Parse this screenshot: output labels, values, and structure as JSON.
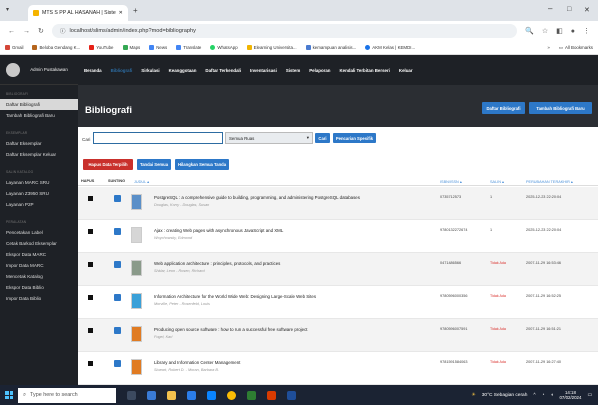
{
  "browser": {
    "tab_title": "MTS S PP AL HASANAH | Siste",
    "url": "localhost/slims/admin/index.php?mod=bibliography",
    "bookmarks": [
      "Gmail",
      "Beloba Gendang K...",
      "YouTube",
      "Maps",
      "News",
      "Translate",
      "WhatsApp",
      "Elearning Universita...",
      "kemampuan analisis...",
      "AKM Kelas | KEMDI..."
    ],
    "all_bookmarks_label": "All Bookmarks"
  },
  "sidebar": {
    "user": "Admin Pustakawan",
    "groups": [
      {
        "label": "BIBLIOGRAFI",
        "items": [
          "Daftar Bibliografi",
          "Tambah Bibliografi Baru"
        ]
      },
      {
        "label": "EKSEMPLAR",
        "items": [
          "Daftar Eksemplar",
          "Daftar Eksemplar Keluar"
        ]
      },
      {
        "label": "SALIN KATALOG",
        "items": [
          "Layanan MARC SRU",
          "Layanan Z3950 SRU",
          "Layanan P2P"
        ]
      },
      {
        "label": "PERALATAN",
        "items": [
          "Pencetakan Label",
          "Cetak Barkod Eksemplar",
          "Ekspor Data MARC",
          "Impor Data MARC",
          "Mencetak Katalog",
          "Ekspor Data Biblio",
          "Impor Data Biblio"
        ]
      }
    ]
  },
  "topnav": [
    "Beranda",
    "Bibliografi",
    "Sirkulasi",
    "Keanggotaan",
    "Daftar Terkendali",
    "Inventarisasi",
    "Sistem",
    "Pelaporan",
    "Kendali Terbitan Berseri",
    "Keluar"
  ],
  "main": {
    "title": "Bibliografi",
    "btn_list": "Daftar Bibliografi",
    "btn_add": "Tambah Bibliografi Baru",
    "search_label": "Cari",
    "search_value": "",
    "search_field": "Semua Ruas",
    "btn_search": "Cari",
    "btn_advanced": "Pencarian Spesifik",
    "btn_delete": "Hapus Data Terpilih",
    "btn_select_all": "Tandai Semua",
    "btn_unselect": "Hilangkan Semua Tanda"
  },
  "table": {
    "headers": {
      "delete": "HAPUS",
      "edit": "SUNTING",
      "title": "JUDUL ▴",
      "isbn": "ISBN/ISSN ▴",
      "copies": "SALIN ▴",
      "updated": "PERUBAHAN TERAKHIR ▴"
    },
    "rows": [
      {
        "title": "PostgreSQL : a comprehensive guide to building, programming, and administering PostgreSQL databases",
        "authors": "Douglas, Korry - Douglas, Susan",
        "isbn": "0735712573",
        "copies": "1",
        "updated": "2025-12-23 22:20:04",
        "thumb": "#5a8fc8"
      },
      {
        "title": "Ajax : creating Web pages with asynchronous JavaScript and XML",
        "authors": "Woychowsky, Edmond",
        "isbn": "9780132272674",
        "copies": "1",
        "updated": "2025-12-23 22:20:04",
        "thumb": "#d6d6d6"
      },
      {
        "title": "Web application architecture : principles, protocols, and practices",
        "authors": "Shklar, Leon - Rosen, Richard",
        "isbn": "0471486566",
        "copies": "Tidak Ada",
        "updated": "2007-11-29 16:53:46",
        "thumb": "#8a9a8a"
      },
      {
        "title": "Information Architecture for the World Wide Web: Designing Large-Scale Web Sites",
        "authors": "Morville, Peter - Rosenfeld, Louis",
        "isbn": "9780596000356",
        "copies": "Tidak Ada",
        "updated": "2007-11-29 16:52:25",
        "thumb": "#3aa0d8"
      },
      {
        "title": "Producing open source software : how to run a successful free software project",
        "authors": "Fogel, Karl",
        "isbn": "9780596007591",
        "copies": "Tidak Ada",
        "updated": "2007-11-29 16:51:21",
        "thumb": "#e07b22"
      },
      {
        "title": "Library and Information Center Management",
        "authors": "Stueart, Robert D. - Moran, Barbara B.",
        "isbn": "9781591584063",
        "copies": "Tidak Ada",
        "updated": "2007-11-29 16:27:40",
        "thumb": "#e07b22"
      }
    ]
  },
  "taskbar": {
    "search_placeholder": "Type here to search",
    "weather": "30°C  Sebagian cerah",
    "time": "14:18",
    "date": "07/02/2024"
  }
}
